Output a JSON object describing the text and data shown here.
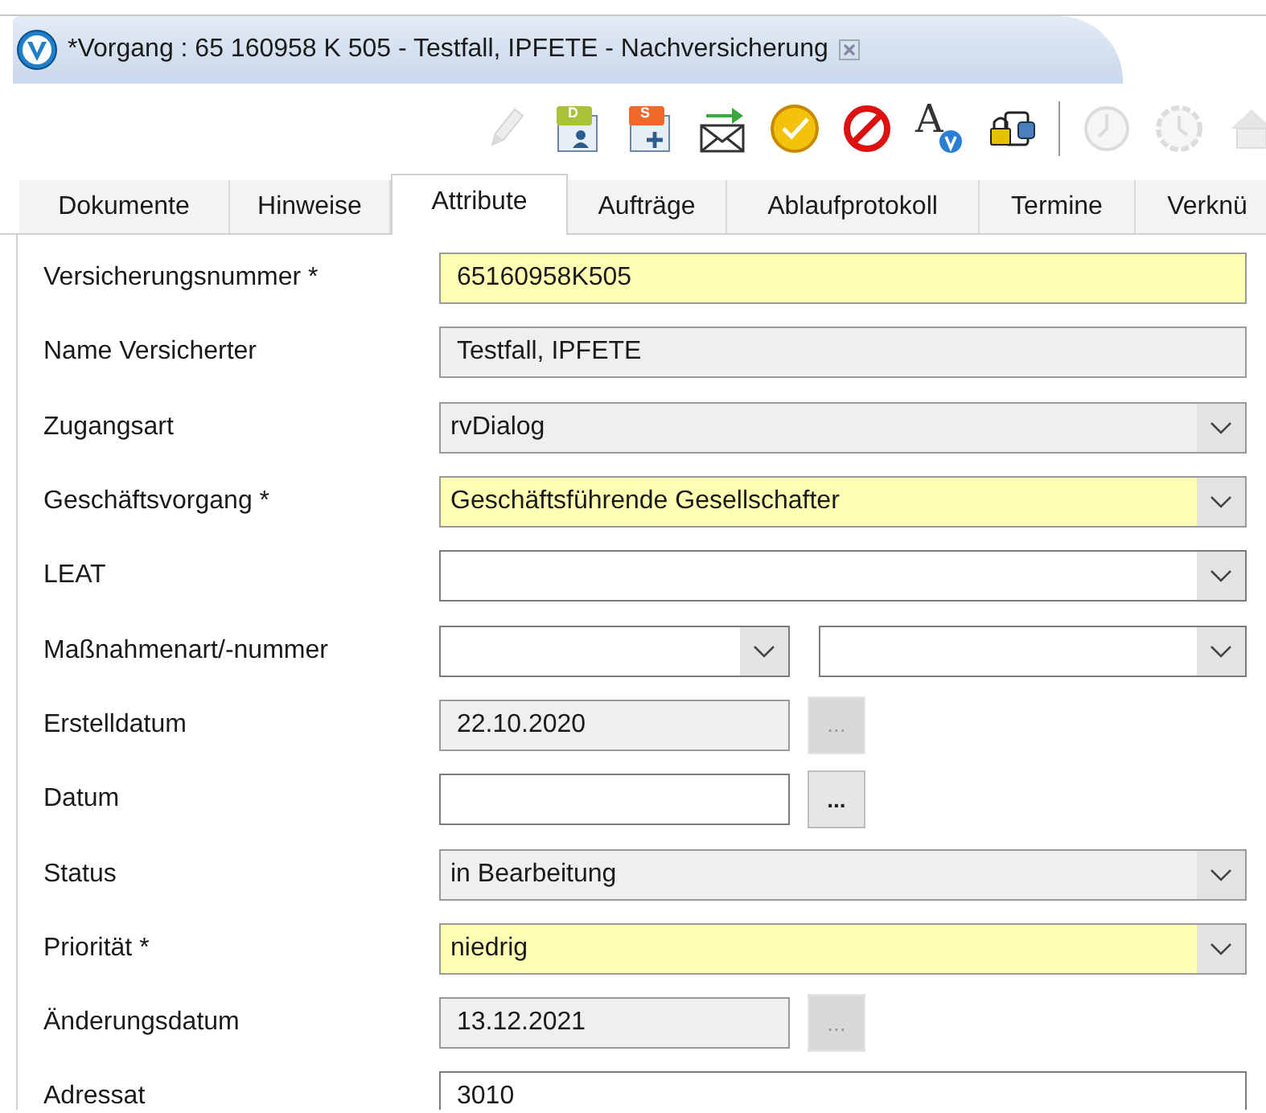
{
  "editor_tab": {
    "title": "*Vorgang : 65 160958 K 505 - Testfall, IPFETE - Nachversicherung"
  },
  "toolbar": [
    {
      "kind": "pencil",
      "disabled": true
    },
    {
      "kind": "doc-person",
      "letter": "D",
      "disabled": false
    },
    {
      "kind": "doc-plus",
      "letter": "S",
      "disabled": false
    },
    {
      "kind": "mail-send",
      "disabled": false
    },
    {
      "kind": "check",
      "disabled": false
    },
    {
      "kind": "forbidden",
      "disabled": false
    },
    {
      "kind": "font-v",
      "letter": "A",
      "disabled": false
    },
    {
      "kind": "lock-doc",
      "disabled": false
    },
    {
      "kind": "separator"
    },
    {
      "kind": "clock",
      "disabled": true
    },
    {
      "kind": "clock-gear",
      "disabled": true
    },
    {
      "kind": "house",
      "disabled": true
    }
  ],
  "tabs": [
    {
      "label": "Dokumente",
      "selected": false
    },
    {
      "label": "Hinweise",
      "selected": false
    },
    {
      "label": "Attribute",
      "selected": true
    },
    {
      "label": "Aufträge",
      "selected": false
    },
    {
      "label": "Ablaufprotokoll",
      "selected": false
    },
    {
      "label": "Termine",
      "selected": false
    },
    {
      "label": "Verknü",
      "selected": false
    }
  ],
  "fields": [
    {
      "label": "Versicherungsnummer *",
      "kind": "text",
      "required": true,
      "value": "65160958K505"
    },
    {
      "label": "Name Versicherter",
      "kind": "text",
      "required": false,
      "readonly": true,
      "value": "Testfall, IPFETE"
    },
    {
      "label": "Zugangsart",
      "kind": "combo",
      "required": false,
      "readonly": true,
      "value": "rvDialog"
    },
    {
      "label": "Geschäftsvorgang *",
      "kind": "combo",
      "required": true,
      "value": "Geschäftsführende Gesellschafter"
    },
    {
      "label": "LEAT",
      "kind": "combo",
      "required": false,
      "readonly": false
    },
    {
      "label": "Maßnahmenart/-nummer",
      "kind": "split-combo",
      "required": false,
      "readonly": false
    },
    {
      "label": "Erstelldatum",
      "kind": "date",
      "required": false,
      "readonly": true,
      "value": "22.10.2020",
      "button": {
        "label": "...",
        "disabled": true
      }
    },
    {
      "label": "Datum",
      "kind": "date",
      "required": false,
      "readonly": false,
      "button": {
        "label": "...",
        "disabled": false
      }
    },
    {
      "label": "Status",
      "kind": "combo",
      "required": false,
      "readonly": true,
      "value": "in Bearbeitung"
    },
    {
      "label": "Priorität *",
      "kind": "combo",
      "required": true,
      "value": "niedrig"
    },
    {
      "label": "Änderungsdatum",
      "kind": "date",
      "required": false,
      "readonly": true,
      "value": "13.12.2021",
      "button": {
        "label": "...",
        "disabled": true
      }
    },
    {
      "label": "Adressat",
      "kind": "text",
      "required": false,
      "readonly": false,
      "value": "3010"
    }
  ]
}
